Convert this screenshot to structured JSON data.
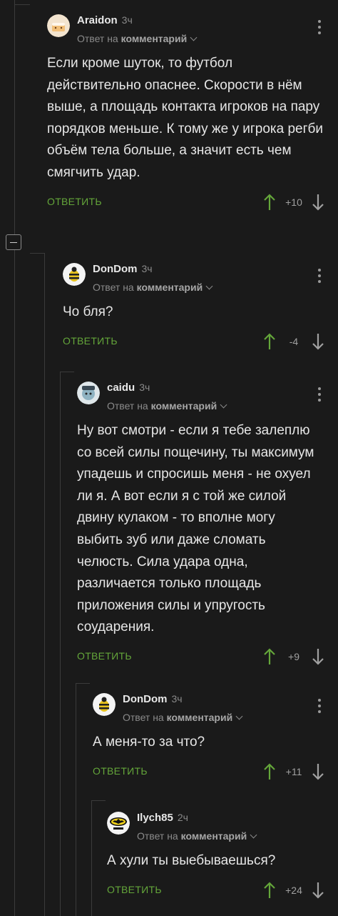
{
  "comments": [
    {
      "author": "Araidon",
      "time": "3ч",
      "reply_prefix": "Ответ на",
      "reply_target": "комментарий",
      "text": "Если кроме шуток, то футбол действительно опаснее. Скорости в нём выше, а площадь контакта игроков на пару порядков меньше. К тому же у игрока регби объём тела больше, а значит есть чем смягчить удар.",
      "reply_label": "ОТВЕТИТЬ",
      "score": "+10",
      "avatar": "cake-avatar"
    },
    {
      "author": "DonDom",
      "time": "3ч",
      "reply_prefix": "Ответ на",
      "reply_target": "комментарий",
      "text": "Чо бля?",
      "reply_label": "ОТВЕТИТЬ",
      "score": "-4",
      "avatar": "bee-avatar"
    },
    {
      "author": "caidu",
      "time": "3ч",
      "reply_prefix": "Ответ на",
      "reply_target": "комментарий",
      "text": "Ну вот смотри - если я тебе залеплю со всей силы пощечину, ты максимум упадешь и спросишь меня - не охуел ли я. А вот если я с той же силой двину кулаком - то вполне могу выбить зуб или даже сломать челюсть. Сила удара одна, различается только площадь приложения силы и упругость соударения.",
      "reply_label": "ОТВЕТИТЬ",
      "score": "+9",
      "avatar": "cartoon-avatar"
    },
    {
      "author": "DonDom",
      "time": "3ч",
      "reply_prefix": "Ответ на",
      "reply_target": "комментарий",
      "text": "А меня-то за что?",
      "reply_label": "ОТВЕТИТЬ",
      "score": "+11",
      "avatar": "bee-avatar"
    },
    {
      "author": "Ilych85",
      "time": "2ч",
      "reply_prefix": "Ответ на",
      "reply_target": "комментарий",
      "text": "А хули ты выебываешься?",
      "reply_label": "ОТВЕТИТЬ",
      "score": "+24",
      "avatar": "batman-avatar"
    }
  ],
  "colors": {
    "background": "#1a1a1a",
    "accent": "#64a63a",
    "muted": "#8a8a8a",
    "thread_line": "#3b3b3b"
  }
}
